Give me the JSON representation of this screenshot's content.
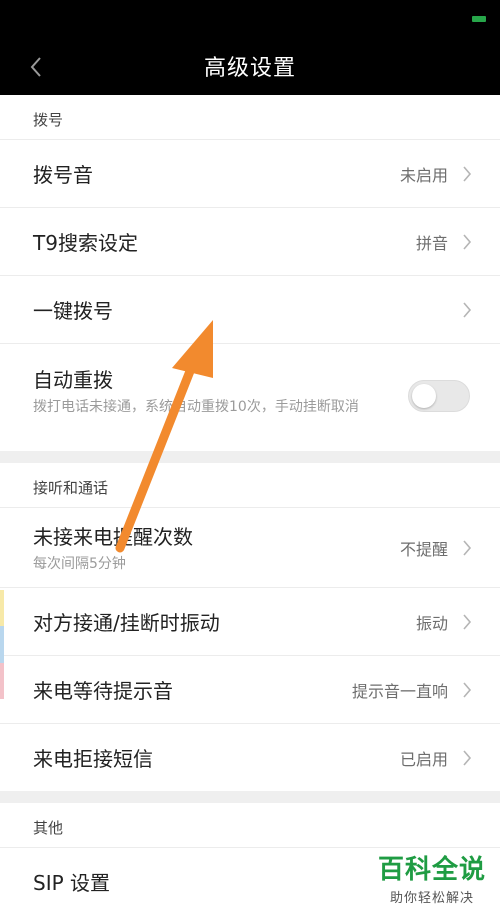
{
  "header": {
    "title": "高级设置"
  },
  "sections": {
    "dial": {
      "title": "拨号",
      "dial_tone": {
        "label": "拨号音",
        "value": "未启用"
      },
      "t9": {
        "label": "T9搜索设定",
        "value": "拼音"
      },
      "speed_dial": {
        "label": "一键拨号"
      },
      "auto_redial": {
        "label": "自动重拨",
        "desc": "拨打电话未接通，系统自动重拨10次，手动挂断取消",
        "enabled": false
      }
    },
    "answer": {
      "title": "接听和通话",
      "missed_reminder": {
        "label": "未接来电提醒次数",
        "desc": "每次间隔5分钟",
        "value": "不提醒"
      },
      "vibrate": {
        "label": "对方接通/挂断时振动",
        "value": "振动"
      },
      "waiting_tone": {
        "label": "来电等待提示音",
        "value": "提示音一直响"
      },
      "reject_sms": {
        "label": "来电拒接短信",
        "value": "已启用"
      }
    },
    "other": {
      "title": "其他",
      "sip": {
        "label": "SIP 设置"
      }
    }
  },
  "watermark": {
    "main": "百科全说",
    "sub": "助你轻松解决"
  },
  "colors": {
    "header_bg": "#000000",
    "arrow": "#f28a2e",
    "watermark": "#1f9c43"
  }
}
